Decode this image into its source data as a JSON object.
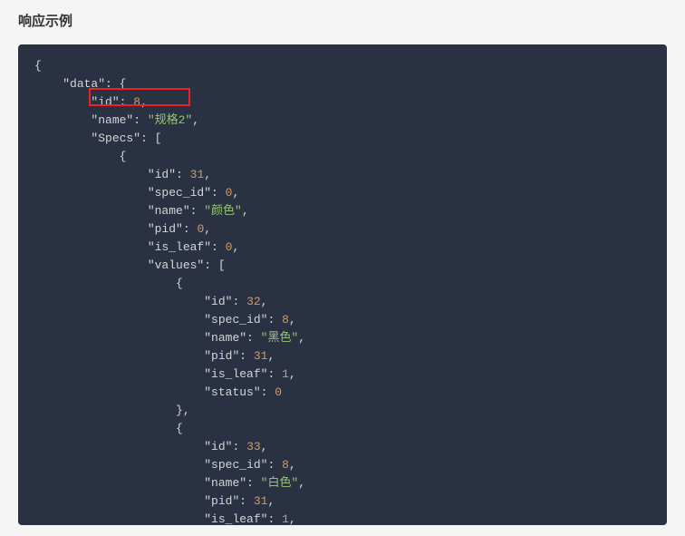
{
  "title": "响应示例",
  "code_tokens": [
    [
      [
        "punc",
        "{"
      ]
    ],
    [
      [
        "indent",
        "    "
      ],
      [
        "key",
        "\"data\""
      ],
      [
        "punc",
        ": {"
      ]
    ],
    [
      [
        "indent",
        "        "
      ],
      [
        "key",
        "\"id\""
      ],
      [
        "punc",
        ": "
      ],
      [
        "num",
        "8"
      ],
      [
        "punc",
        ","
      ]
    ],
    [
      [
        "indent",
        "        "
      ],
      [
        "key",
        "\"name\""
      ],
      [
        "punc",
        ": "
      ],
      [
        "str",
        "\"规格2\""
      ],
      [
        "punc",
        ","
      ]
    ],
    [
      [
        "indent",
        "        "
      ],
      [
        "key",
        "\"Specs\""
      ],
      [
        "punc",
        ": ["
      ]
    ],
    [
      [
        "indent",
        "            "
      ],
      [
        "punc",
        "{"
      ]
    ],
    [
      [
        "indent",
        "                "
      ],
      [
        "key",
        "\"id\""
      ],
      [
        "punc",
        ": "
      ],
      [
        "num",
        "31"
      ],
      [
        "punc",
        ","
      ]
    ],
    [
      [
        "indent",
        "                "
      ],
      [
        "key",
        "\"spec_id\""
      ],
      [
        "punc",
        ": "
      ],
      [
        "num",
        "0"
      ],
      [
        "punc",
        ","
      ]
    ],
    [
      [
        "indent",
        "                "
      ],
      [
        "key",
        "\"name\""
      ],
      [
        "punc",
        ": "
      ],
      [
        "str",
        "\"颜色\""
      ],
      [
        "punc",
        ","
      ]
    ],
    [
      [
        "indent",
        "                "
      ],
      [
        "key",
        "\"pid\""
      ],
      [
        "punc",
        ": "
      ],
      [
        "num",
        "0"
      ],
      [
        "punc",
        ","
      ]
    ],
    [
      [
        "indent",
        "                "
      ],
      [
        "key",
        "\"is_leaf\""
      ],
      [
        "punc",
        ": "
      ],
      [
        "num",
        "0"
      ],
      [
        "punc",
        ","
      ]
    ],
    [
      [
        "indent",
        "                "
      ],
      [
        "key",
        "\"values\""
      ],
      [
        "punc",
        ": ["
      ]
    ],
    [
      [
        "indent",
        "                    "
      ],
      [
        "punc",
        "{"
      ]
    ],
    [
      [
        "indent",
        "                        "
      ],
      [
        "key",
        "\"id\""
      ],
      [
        "punc",
        ": "
      ],
      [
        "num",
        "32"
      ],
      [
        "punc",
        ","
      ]
    ],
    [
      [
        "indent",
        "                        "
      ],
      [
        "key",
        "\"spec_id\""
      ],
      [
        "punc",
        ": "
      ],
      [
        "num",
        "8"
      ],
      [
        "punc",
        ","
      ]
    ],
    [
      [
        "indent",
        "                        "
      ],
      [
        "key",
        "\"name\""
      ],
      [
        "punc",
        ": "
      ],
      [
        "str",
        "\"黑色\""
      ],
      [
        "punc",
        ","
      ]
    ],
    [
      [
        "indent",
        "                        "
      ],
      [
        "key",
        "\"pid\""
      ],
      [
        "punc",
        ": "
      ],
      [
        "num",
        "31"
      ],
      [
        "punc",
        ","
      ]
    ],
    [
      [
        "indent",
        "                        "
      ],
      [
        "key",
        "\"is_leaf\""
      ],
      [
        "punc",
        ": "
      ],
      [
        "num",
        "1"
      ],
      [
        "punc",
        ","
      ]
    ],
    [
      [
        "indent",
        "                        "
      ],
      [
        "key",
        "\"status\""
      ],
      [
        "punc",
        ": "
      ],
      [
        "num",
        "0"
      ]
    ],
    [
      [
        "indent",
        "                    "
      ],
      [
        "punc",
        "},"
      ]
    ],
    [
      [
        "indent",
        "                    "
      ],
      [
        "punc",
        "{"
      ]
    ],
    [
      [
        "indent",
        "                        "
      ],
      [
        "key",
        "\"id\""
      ],
      [
        "punc",
        ": "
      ],
      [
        "num",
        "33"
      ],
      [
        "punc",
        ","
      ]
    ],
    [
      [
        "indent",
        "                        "
      ],
      [
        "key",
        "\"spec_id\""
      ],
      [
        "punc",
        ": "
      ],
      [
        "num",
        "8"
      ],
      [
        "punc",
        ","
      ]
    ],
    [
      [
        "indent",
        "                        "
      ],
      [
        "key",
        "\"name\""
      ],
      [
        "punc",
        ": "
      ],
      [
        "str",
        "\"白色\""
      ],
      [
        "punc",
        ","
      ]
    ],
    [
      [
        "indent",
        "                        "
      ],
      [
        "key",
        "\"pid\""
      ],
      [
        "punc",
        ": "
      ],
      [
        "num",
        "31"
      ],
      [
        "punc",
        ","
      ]
    ],
    [
      [
        "indent",
        "                        "
      ],
      [
        "key",
        "\"is_leaf\""
      ],
      [
        "punc",
        ": "
      ],
      [
        "num",
        "1"
      ],
      [
        "punc",
        ","
      ]
    ]
  ],
  "highlight": {
    "line_index": 2
  }
}
